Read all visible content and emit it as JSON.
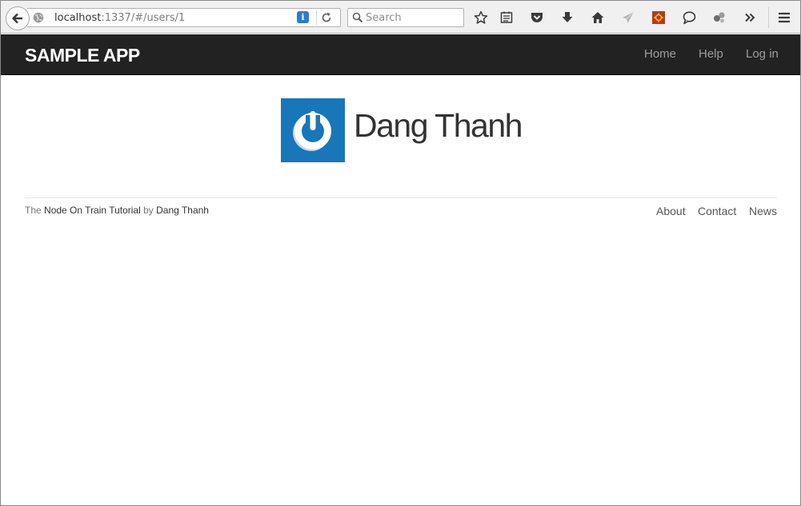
{
  "browser": {
    "url_host": "localhost",
    "url_path": ":1337/#/users/1",
    "search_placeholder": "Search",
    "info_icon_char": "i",
    "toolbar_icons": [
      "star-icon",
      "reading-list-icon",
      "pocket-icon",
      "download-icon",
      "home-icon",
      "send-icon",
      "extension-icon",
      "chat-icon",
      "connect-icon",
      "overflow-icon",
      "menu-icon"
    ]
  },
  "navbar": {
    "brand": "SAMPLE APP",
    "links": [
      "Home",
      "Help",
      "Log in"
    ]
  },
  "profile": {
    "name": "Dang Thanh",
    "avatar_color": "#1777b9"
  },
  "footer": {
    "prefix": "The",
    "tutorial_link": "Node On Train Tutorial",
    "by": "by",
    "author_link": "Dang Thanh",
    "links": [
      "About",
      "Contact",
      "News"
    ]
  },
  "colors": {
    "navbar_bg": "#222222",
    "nav_link": "#9d9d9d",
    "accent": "#1777b9"
  }
}
